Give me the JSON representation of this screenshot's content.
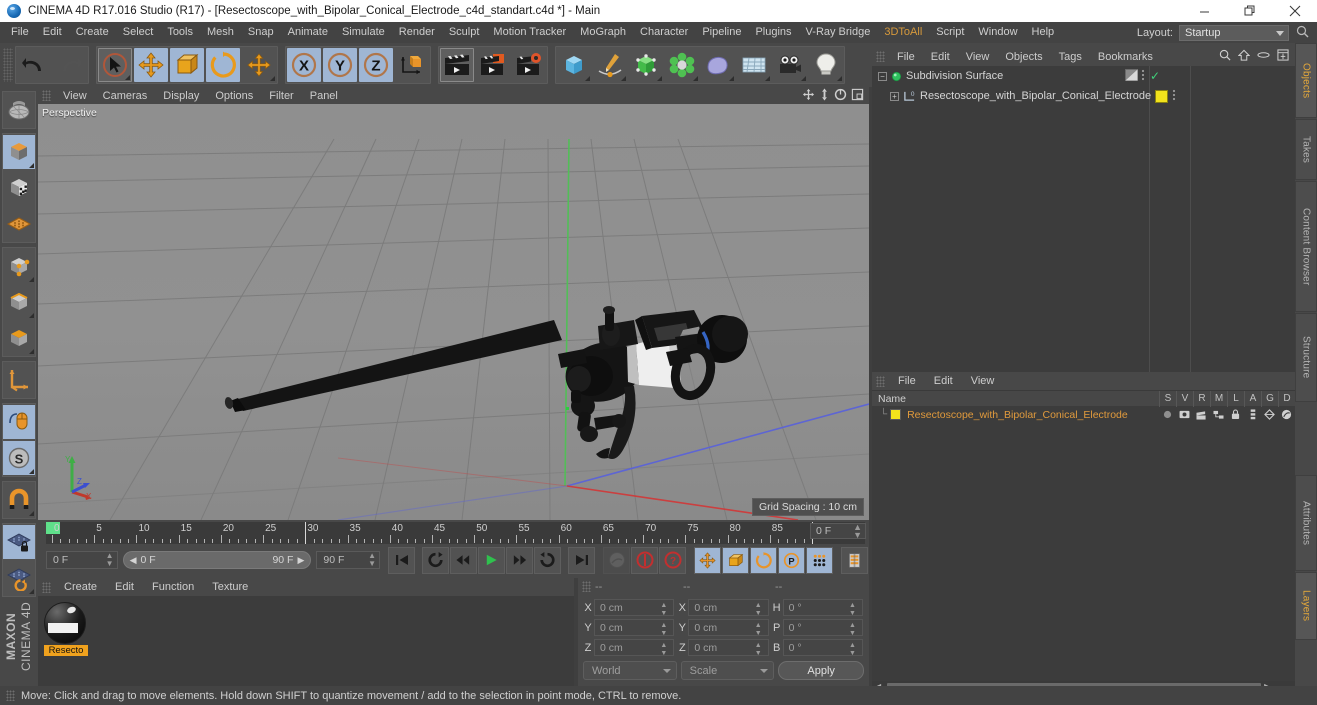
{
  "window": {
    "title": "CINEMA 4D R17.016 Studio (R17) - [Resectoscope_with_Bipolar_Conical_Electrode_c4d_standart.c4d *] - Main",
    "minimize_label": "Minimize",
    "maximize_label": "Restore",
    "close_label": "Close"
  },
  "menubar": {
    "items": [
      {
        "label": "File"
      },
      {
        "label": "Edit"
      },
      {
        "label": "Create"
      },
      {
        "label": "Select"
      },
      {
        "label": "Tools"
      },
      {
        "label": "Mesh"
      },
      {
        "label": "Snap"
      },
      {
        "label": "Animate"
      },
      {
        "label": "Simulate"
      },
      {
        "label": "Render"
      },
      {
        "label": "Sculpt"
      },
      {
        "label": "Motion Tracker"
      },
      {
        "label": "MoGraph"
      },
      {
        "label": "Character"
      },
      {
        "label": "Pipeline"
      },
      {
        "label": "Plugins"
      },
      {
        "label": "V-Ray Bridge"
      },
      {
        "label": "3DToAll",
        "highlight": true
      },
      {
        "label": "Script"
      },
      {
        "label": "Window"
      },
      {
        "label": "Help"
      }
    ],
    "layout_label": "Layout:",
    "layout_value": "Startup",
    "search_icon": "search-icon"
  },
  "toolbar": {
    "groups": [
      {
        "name": "history",
        "buttons": [
          {
            "name": "undo-button",
            "icon": "undo-arrow-icon",
            "state": "normal"
          },
          {
            "name": "redo-button",
            "icon": "redo-arrow-icon",
            "state": "disabled"
          }
        ]
      },
      {
        "name": "transform-tools",
        "buttons": [
          {
            "name": "select-tool",
            "icon": "cursor-select-icon",
            "state": "selected"
          },
          {
            "name": "move-tool",
            "icon": "move-arrows-icon",
            "state": "active"
          },
          {
            "name": "scale-tool",
            "icon": "scale-square-icon",
            "state": "active"
          },
          {
            "name": "rotate-tool",
            "icon": "rotate-circle-icon",
            "state": "active"
          },
          {
            "name": "transform-tool",
            "icon": "move-arrows-icon",
            "state": "normal"
          }
        ]
      },
      {
        "name": "axis-locks",
        "buttons": [
          {
            "name": "lock-x-axis",
            "icon": "x-axis-icon",
            "state": "active"
          },
          {
            "name": "lock-y-axis",
            "icon": "y-axis-icon",
            "state": "active"
          },
          {
            "name": "lock-z-axis",
            "icon": "z-axis-icon",
            "state": "active"
          },
          {
            "name": "world-object-coordinates",
            "icon": "world-cube-icon",
            "state": "normal"
          }
        ]
      },
      {
        "name": "render-tools",
        "buttons": [
          {
            "name": "render-view-button",
            "icon": "clapperboard-icon",
            "state": "selected"
          },
          {
            "name": "render-region-button",
            "icon": "clapperboard-region-icon",
            "state": "normal"
          },
          {
            "name": "render-settings-button",
            "icon": "clapperboard-gear-icon",
            "state": "normal"
          }
        ]
      },
      {
        "name": "create-objects",
        "buttons": [
          {
            "name": "add-primitive-cube",
            "icon": "blue-cube-icon",
            "state": "normal"
          },
          {
            "name": "add-spline-pen",
            "icon": "spline-pen-icon",
            "state": "normal"
          },
          {
            "name": "add-generator",
            "icon": "green-cube-generator-icon",
            "state": "normal"
          },
          {
            "name": "add-deformer",
            "icon": "green-deformer-icon",
            "state": "normal"
          },
          {
            "name": "add-environment",
            "icon": "environment-blob-icon",
            "state": "normal"
          },
          {
            "name": "add-scene-object",
            "icon": "floor-grid-icon",
            "state": "normal"
          },
          {
            "name": "add-camera",
            "icon": "camera-icon",
            "state": "normal"
          },
          {
            "name": "add-light",
            "icon": "light-bulb-icon",
            "state": "normal"
          }
        ]
      }
    ]
  },
  "left_toolbar": {
    "groups": [
      {
        "buttons": [
          {
            "name": "make-editable-button",
            "icon": "globe-wire-icon",
            "state": "normal"
          }
        ]
      },
      {
        "buttons": [
          {
            "name": "model-mode-button",
            "icon": "orange-cube-icon",
            "state": "active"
          },
          {
            "name": "texture-mode-button",
            "icon": "checker-cube-icon",
            "state": "normal"
          },
          {
            "name": "uv-mesh-mode-button",
            "icon": "orange-mesh-icon",
            "state": "normal"
          }
        ]
      },
      {
        "buttons": [
          {
            "name": "points-mode-button",
            "icon": "points-cube-icon",
            "state": "normal"
          },
          {
            "name": "edges-mode-button",
            "icon": "edges-cube-icon",
            "state": "normal"
          },
          {
            "name": "polygons-mode-button",
            "icon": "polygons-cube-icon",
            "state": "normal"
          }
        ]
      },
      {
        "buttons": [
          {
            "name": "axis-mode-button",
            "icon": "axis-tripod-icon",
            "state": "normal"
          }
        ]
      },
      {
        "buttons": [
          {
            "name": "enable-axis-button",
            "icon": "mouse-axis-icon",
            "state": "active"
          },
          {
            "name": "soft-selection-button",
            "icon": "s-circle-icon",
            "state": "active"
          }
        ]
      },
      {
        "buttons": [
          {
            "name": "snap-magnet-button",
            "icon": "magnet-icon",
            "state": "normal"
          }
        ]
      },
      {
        "buttons": [
          {
            "name": "lock-workplane-button",
            "icon": "workplane-lock-icon",
            "state": "active"
          },
          {
            "name": "planar-workplane-button",
            "icon": "workplane-rotate-icon",
            "state": "normal"
          }
        ]
      }
    ],
    "brand_top": "MAXON",
    "brand_bottom": "CINEMA 4D"
  },
  "viewport": {
    "menu_items": [
      {
        "label": "View"
      },
      {
        "label": "Cameras"
      },
      {
        "label": "Display"
      },
      {
        "label": "Options"
      },
      {
        "label": "Filter"
      },
      {
        "label": "Panel"
      }
    ],
    "corner_icons": [
      {
        "name": "pan-view-icon"
      },
      {
        "name": "dolly-view-icon"
      },
      {
        "name": "rotate-view-icon"
      },
      {
        "name": "maximize-view-icon"
      }
    ],
    "label": "Perspective",
    "grid_spacing": "Grid Spacing : 10 cm",
    "axis_labels": {
      "x": "X",
      "y": "Y",
      "z": "Z"
    },
    "colors": {
      "x_axis": "#d03a3a",
      "y_axis": "#49c24a",
      "z_axis": "#5b63d8",
      "background": "#8e8e8e",
      "grid": "#7c7c7c"
    }
  },
  "timeline": {
    "ticks": [
      {
        "label": "0",
        "pos": 0
      },
      {
        "label": "5",
        "pos": 5
      },
      {
        "label": "10",
        "pos": 10
      },
      {
        "label": "15",
        "pos": 15
      },
      {
        "label": "20",
        "pos": 20
      },
      {
        "label": "25",
        "pos": 25
      },
      {
        "label": "30",
        "pos": 30
      },
      {
        "label": "35",
        "pos": 35
      },
      {
        "label": "40",
        "pos": 40
      },
      {
        "label": "45",
        "pos": 45
      },
      {
        "label": "50",
        "pos": 50
      },
      {
        "label": "55",
        "pos": 55
      },
      {
        "label": "60",
        "pos": 60
      },
      {
        "label": "65",
        "pos": 65
      },
      {
        "label": "70",
        "pos": 70
      },
      {
        "label": "75",
        "pos": 75
      },
      {
        "label": "80",
        "pos": 80
      },
      {
        "label": "85",
        "pos": 85
      },
      {
        "label": "90",
        "pos": 90
      }
    ],
    "range_min": 0,
    "range_max": 90,
    "current_frame_ruler": "0 F",
    "current_frame": "0 F",
    "preview_start": "0 F",
    "preview_end": "90 F",
    "max_frame": "90 F",
    "transport": [
      {
        "name": "go-to-start-button",
        "icon": "skip-start-icon"
      },
      {
        "name": "play-backwards-loop-button",
        "icon": "loop-back-icon"
      },
      {
        "name": "step-back-button",
        "icon": "step-back-icon"
      },
      {
        "name": "play-button",
        "icon": "play-icon"
      },
      {
        "name": "step-forward-button",
        "icon": "step-forward-icon"
      },
      {
        "name": "play-forward-loop-button",
        "icon": "loop-forward-icon"
      },
      {
        "name": "go-to-end-button",
        "icon": "skip-end-icon"
      }
    ],
    "keyframe_tools": [
      {
        "name": "record-active-objects-button",
        "icon": "record-disc-icon",
        "state": "disabled"
      },
      {
        "name": "autokeying-button",
        "icon": "red-key-icon",
        "state": "normal"
      },
      {
        "name": "keyframe-selection-button",
        "icon": "red-question-icon",
        "state": "normal"
      },
      {
        "name": "position-key-button",
        "icon": "move-arrows-icon",
        "state": "active"
      },
      {
        "name": "scale-key-button",
        "icon": "scale-square-icon",
        "state": "active"
      },
      {
        "name": "rotation-key-button",
        "icon": "rotate-circle-icon",
        "state": "active"
      },
      {
        "name": "param-key-button",
        "icon": "p-circle-icon",
        "state": "active"
      },
      {
        "name": "point-level-animation-button",
        "icon": "dots-grid-icon",
        "state": "active"
      },
      {
        "name": "timeline-view-button",
        "icon": "timeline-bars-icon",
        "state": "normal"
      }
    ]
  },
  "material_manager": {
    "menu_items": [
      {
        "label": "Create"
      },
      {
        "label": "Edit"
      },
      {
        "label": "Function"
      },
      {
        "label": "Texture"
      }
    ],
    "materials": [
      {
        "name": "Resecto",
        "selected": true
      }
    ]
  },
  "coordinate_manager": {
    "header_dashes": [
      "--",
      "--",
      "--"
    ],
    "rows": [
      {
        "pos_label": "X",
        "pos_value": "0 cm",
        "size_label": "X",
        "size_value": "0 cm",
        "rot_label": "H",
        "rot_value": "0 °"
      },
      {
        "pos_label": "Y",
        "pos_value": "0 cm",
        "size_label": "Y",
        "size_value": "0 cm",
        "rot_label": "P",
        "rot_value": "0 °"
      },
      {
        "pos_label": "Z",
        "pos_value": "0 cm",
        "size_label": "Z",
        "size_value": "0 cm",
        "rot_label": "B",
        "rot_value": "0 °"
      }
    ],
    "coordinate_system": "World",
    "size_mode": "Scale",
    "apply_label": "Apply"
  },
  "object_manager": {
    "menu_items": [
      {
        "label": "File"
      },
      {
        "label": "Edit"
      },
      {
        "label": "View"
      },
      {
        "label": "Objects"
      },
      {
        "label": "Tags"
      },
      {
        "label": "Bookmarks"
      }
    ],
    "header_icons": [
      {
        "name": "search-icon"
      },
      {
        "name": "home-up-icon"
      },
      {
        "name": "collapse-icon"
      },
      {
        "name": "fit-icon"
      }
    ],
    "items": [
      {
        "label": "Subdivision Surface",
        "icon": "subdivision-surface-icon",
        "depth": 0,
        "tag_icon": "display-tag-icon",
        "check": "✓"
      },
      {
        "label": "Resectoscope_with_Bipolar_Conical_Electrode",
        "icon": "polygon-object-icon",
        "depth": 1,
        "tag_icon": "material-tag-icon",
        "tag_color": "#f2e31c"
      }
    ]
  },
  "layer_manager": {
    "menu_items": [
      {
        "label": "File"
      },
      {
        "label": "Edit"
      },
      {
        "label": "View"
      }
    ],
    "columns": [
      "Name",
      "S",
      "V",
      "R",
      "M",
      "L",
      "A",
      "G",
      "D"
    ],
    "rows": [
      {
        "name": "Resectoscope_with_Bipolar_Conical_Electrode",
        "color": "#f2e31c",
        "cells": [
          "solo-dot",
          "view-icon",
          "render-icon",
          "manager-icon",
          "lock-icon",
          "animation-icon",
          "generator-icon",
          "deformer-icon"
        ]
      }
    ]
  },
  "right_tabs": [
    {
      "label": "Objects",
      "active": true
    },
    {
      "label": "Takes",
      "active": false
    },
    {
      "label": "Content Browser",
      "active": false
    },
    {
      "label": "Structure",
      "active": false
    },
    {
      "label": "Attributes",
      "active": false
    },
    {
      "label": "Layers",
      "active": true
    }
  ],
  "statusbar": {
    "message": "Move: Click and drag to move elements. Hold down SHIFT to quantize movement / add to the selection in point mode, CTRL to remove."
  }
}
